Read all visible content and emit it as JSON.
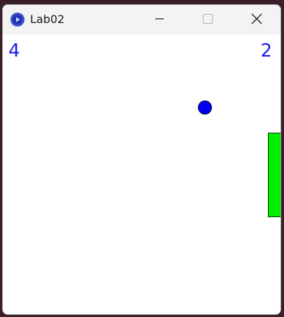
{
  "window": {
    "title": "Lab02",
    "controls": {
      "minimize_icon": "minimize-icon",
      "maximize_icon": "maximize-icon",
      "close_icon": "close-icon"
    }
  },
  "game": {
    "score_left": "4",
    "score_right": "2",
    "colors": {
      "score": "#1a1aee",
      "ball": "#0000f0",
      "paddle": "#00ee00",
      "background": "#ffffff"
    }
  }
}
